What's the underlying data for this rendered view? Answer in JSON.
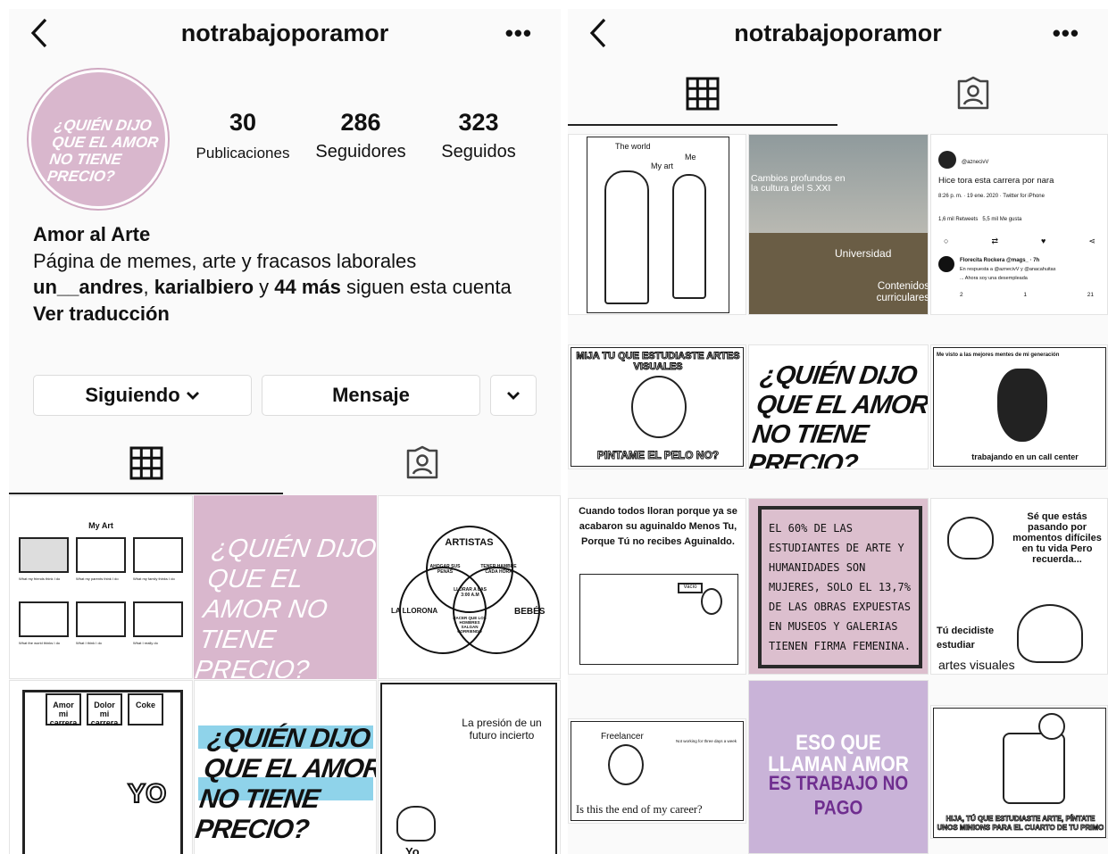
{
  "left": {
    "username": "notrabajoporamor",
    "avatar_text": "¿QUIÉN DIJO QUE EL AMOR NO TIENE PRECIO?",
    "stats": [
      {
        "number": "30",
        "label": "Publicaciones"
      },
      {
        "number": "286",
        "label": "Seguidores"
      },
      {
        "number": "323",
        "label": "Seguidos"
      }
    ],
    "bio": {
      "name": "Amor al Arte",
      "description": "Página de memes, arte y fracasos laborales",
      "followed_user1": "un__andres",
      "followed_sep": ", ",
      "followed_user2": "karialbiero",
      "followed_and": " y ",
      "followed_more": "44 más",
      "followed_tail": " siguen esta cuenta",
      "translate": "Ver traducción"
    },
    "buttons": {
      "following": "Siguiendo",
      "message": "Mensaje"
    },
    "posts": [
      {
        "title": "My Art",
        "captions": [
          "What my friends think I do",
          "What my parents think I do",
          "What my family thinks I do",
          "What the world thinks I do",
          "What I think I do",
          "What I really do"
        ]
      },
      {
        "text": "¿QUIÉN DIJO QUE EL AMOR NO TIENE PRECIO?"
      },
      {
        "title": "ARTISTAS",
        "labels": [
          "AHOGAR SUS PENAS",
          "TENER HAMBRE CADA HORA",
          "LLORAR A LAS 3:00 A.M",
          "LA LLORONA",
          "BEBÉS",
          "HACER QUE LOS HOMBRES SALGAN CORRIENDO"
        ]
      },
      {
        "labels": [
          "Amor mi carrera",
          "Dolor mi carrera",
          "Coke",
          "YO"
        ]
      },
      {
        "text": "¿QUIÉN DIJO QUE EL AMOR NO TIENE PRECIO?"
      },
      {
        "labels": [
          "La presión de un futuro incierto",
          "Yo"
        ]
      }
    ]
  },
  "right": {
    "username": "notrabajoporamor",
    "posts": [
      {
        "labels": [
          "The world",
          "My art",
          "Me"
        ]
      },
      {
        "labels": [
          "Cambios profundos en la cultura del S.XXI",
          "Universidad",
          "Contenidos curriculares"
        ]
      },
      {
        "handle": "@aznecivV",
        "tweet": "Hice tora esta carrera por nara",
        "meta": "8:26 p. m. · 19 ene. 2020 · Twitter for iPhone",
        "counts": "1,6 mil Retweets   5,5 mil Me gusta",
        "reply_user": "Florecita Rockera @mags_  · 7h",
        "reply_to": "En respuesta a @aznecivV y @anacahuitas",
        "reply_text": "... Ahora soy una desempleada",
        "reply_counts": [
          "2",
          "1",
          "21"
        ]
      },
      {
        "top": "MIJA TU QUE ESTUDIASTE ARTES VISUALES",
        "bottom": "PINTAME EL PELO NO?"
      },
      {
        "text": "¿QUIÉN DIJO QUE EL AMOR NO TIENE PRECIO?"
      },
      {
        "top": "Me visto a las mejores mentes de mi generación",
        "bottom": "trabajando en un call center"
      },
      {
        "text": "Cuando todos lloran porque ya se acabaron su aguinaldo Menos Tu, Porque Tú no recibes Aguinaldo.",
        "sign": "Vacío"
      },
      {
        "text": "EL 60% DE LAS ESTUDIANTES DE ARTE Y HUMANIDADES SON MUJERES, SOLO EL 13,7% DE LAS OBRAS EXPUESTAS EN MUSEOS Y GALERIAS TIENEN FIRMA FEMENINA."
      },
      {
        "top": "Sé que estás pasando por momentos difíciles en tu vida Pero recuerda...",
        "mid": "Tú decidiste estudiar",
        "bottom": "artes visuales"
      },
      {
        "labels": [
          "Freelancer",
          "Not working for three days a week",
          "Is this the end of my career?"
        ]
      },
      {
        "lines": [
          "ESO QUE",
          "LLAMAN AMOR",
          "ES TRABAJO NO PAGO"
        ]
      },
      {
        "caption": "HIJA, TÚ QUE ESTUDIASTE ARTE, PÍNTATE UNOS MINIONS PARA EL CUARTO DE TU PRIMO"
      }
    ]
  },
  "colors": {
    "pink": "#d9b7cd",
    "lavender": "#c9b3d8",
    "accent_cyan": "#8fd3ea",
    "violet_text": "#6f2e8f"
  }
}
